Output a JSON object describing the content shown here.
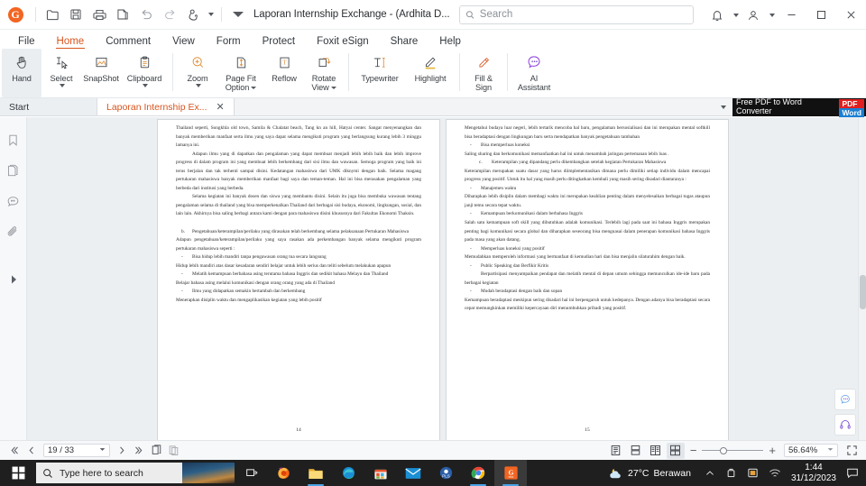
{
  "window": {
    "document_title": "Laporan Internship Exchange - (Ardhita D...",
    "app_logo": "foxit-logo-icon"
  },
  "search": {
    "placeholder": "Search",
    "value": ""
  },
  "titlebar_icons": [
    "open-folder-icon",
    "save-icon",
    "print-icon",
    "copy-icon",
    "undo-icon",
    "redo-icon",
    "touch-mode-icon",
    "chevron-down-icon"
  ],
  "titlebar_right": {
    "notifications": "bell-icon",
    "account": "account-icon",
    "minimize": "minimize-icon",
    "maximize": "maximize-icon",
    "close": "close-icon"
  },
  "menu": {
    "items": [
      {
        "label": "File",
        "active": false
      },
      {
        "label": "Home",
        "active": true
      },
      {
        "label": "Comment",
        "active": false
      },
      {
        "label": "View",
        "active": false
      },
      {
        "label": "Form",
        "active": false
      },
      {
        "label": "Protect",
        "active": false
      },
      {
        "label": "Foxit eSign",
        "active": false
      },
      {
        "label": "Share",
        "active": false
      },
      {
        "label": "Help",
        "active": false
      }
    ]
  },
  "ribbon": {
    "groups": [
      {
        "buttons": [
          {
            "label": "Hand",
            "icon": "hand-icon",
            "caret": false,
            "active": true
          },
          {
            "label": "Select",
            "icon": "select-text-icon",
            "caret": true,
            "active": false
          },
          {
            "label": "SnapShot",
            "icon": "snapshot-icon",
            "caret": false,
            "active": false
          },
          {
            "label": "Clipboard",
            "icon": "clipboard-icon",
            "caret": true,
            "active": false
          }
        ]
      },
      {
        "buttons": [
          {
            "label": "Zoom",
            "icon": "zoom-in-icon",
            "caret": true,
            "active": false
          },
          {
            "label": "Page Fit Option",
            "icon": "page-fit-icon",
            "caret": true,
            "active": false
          },
          {
            "label": "Reflow",
            "icon": "reflow-icon",
            "caret": false,
            "active": false
          },
          {
            "label": "Rotate View",
            "icon": "rotate-view-icon",
            "caret": true,
            "active": false
          }
        ]
      },
      {
        "buttons": [
          {
            "label": "Typewriter",
            "icon": "typewriter-icon",
            "caret": false,
            "active": false
          },
          {
            "label": "Highlight",
            "icon": "highlight-icon",
            "caret": false,
            "active": false
          }
        ]
      },
      {
        "buttons": [
          {
            "label": "Fill & Sign",
            "icon": "fill-sign-icon",
            "caret": false,
            "active": false
          }
        ]
      },
      {
        "buttons": [
          {
            "label": "AI Assistant",
            "icon": "ai-assistant-icon",
            "caret": false,
            "active": false
          }
        ]
      }
    ]
  },
  "tabs": [
    {
      "label": "Start",
      "active": false,
      "closable": false
    },
    {
      "label": "Laporan Internship Ex...",
      "active": true,
      "closable": true
    }
  ],
  "ad": {
    "line1": "Free PDF to Word",
    "line2": "Converter",
    "badge_pdf": "PDF",
    "badge_word": "Word"
  },
  "left_rail": {
    "items": [
      {
        "name": "bookmarks-icon"
      },
      {
        "name": "page-thumbnails-icon"
      },
      {
        "name": "comments-icon"
      },
      {
        "name": "attachments-icon"
      }
    ],
    "expand": "expand-panel-arrow-icon"
  },
  "document": {
    "left_page": {
      "page_number": "14",
      "blocks": [
        {
          "type": "p",
          "text": "Thailand seperti, Songkhla old town, Samila & Chalatat beach, Tang kn an hill, Hatyai center. Sangat menyenangkan dan banyak memberikan manfaat serta ilmu yang saya dapat selama mengikuti program yang berlangsung kurang lebih 3 minggu lamanya ini."
        },
        {
          "type": "p-indent",
          "text": "Adapun ilmu yang di dapatkan dan pengalaman yang dapat membuat menjadi lebih lebih baik dan lebih improve progress di dalam program ini yang membuat lebih berkembang dari sisi ilmu dan wawasan. Semoga program yang baik ini terus berjalan dan tak terhenti sampai disini. Kedatangan mahasiswa dari UMK diknymi dengan baik. Selama magang pertukaran mahasiswa banyak memberikan manfaat bagi saya dan teman-teman. Hal ini bisa merasakan pengalaman yang berbeda dari institusi yang berbeda."
        },
        {
          "type": "p-indent",
          "text": "Selama kegiatan ini banyak dosen dan siswa yang membantu disini. Selain itu juga bisa membuka wawasan tentang pengalaman selama di thailand yang bisa memperkenalkan Thailand dari berbagai sisi budaya, ekonomi, lingkungan, sosial, dan lain lain. Akhirnya bisa saling berbagi antara kami dengan para mahasiswa disini khususnya dari Fakultas Ekonomi Thaksin."
        },
        {
          "type": "li-b",
          "marker": "b.",
          "text": "Pengetahuan/keterampilan/perilaku yang dirasakan telah berkembang selama pelaksanaan Pertukaran Mahasiswa"
        },
        {
          "type": "p",
          "text": "Adapun pengetahuan/keterampilan/perilaku yang saya rasakan ada perkembangan banyak selama mengikuti program pertukaran mahasiswa seperti :"
        },
        {
          "type": "li-dash",
          "marker": "-",
          "text": "Bisa hidup lebih mandiri tanpa pengawasan orang tua secara langsung"
        },
        {
          "type": "p",
          "text": "Hidup lebih mandiri atas dasar kesadaran sendiri belajar untuk lebih serius dan teliti sebelum melakukan apapun"
        },
        {
          "type": "li-dash",
          "marker": "-",
          "text": "Melatih kemampuan berbahasa asing terutama bahasa Inggris dan sedikit bahasa Melayu dan Thailand"
        },
        {
          "type": "p",
          "text": "Belajar bahasa asing melalui komunikasi dengan orang orang yang ada di Thailand"
        },
        {
          "type": "li-dash",
          "marker": "-",
          "text": "Ilmu yang didapatkan semakin bertambah dan berkembang"
        },
        {
          "type": "p",
          "text": "Menerapkan disiplin waktu dan mengaplikasikan kegiatan yang lebih positif"
        }
      ]
    },
    "right_page": {
      "page_number": "15",
      "blocks": [
        {
          "type": "p",
          "text": "Mengetahui budaya luar negeri, lebih tertarik mencoba hal baru, pengalaman bersosialisasi dan ini merupakan mental softkill bisa beradaptasi dengan lingkungan baru serta mendapatkan banyak pengetahuan tambahan"
        },
        {
          "type": "li-dash",
          "marker": "-",
          "text": "Bisa memperluas koneksi"
        },
        {
          "type": "p",
          "text": "Saling sharing dan berkomunikasi memanfaatkan hal ini untuk menambah jaringan pertemanan lebih luas ."
        },
        {
          "type": "li-b",
          "marker": "c.",
          "text": "Keterampilan yang dipandang perlu dikembangkan setelah kegiatan Pertukaran Mahasiswa"
        },
        {
          "type": "p",
          "text": "Keterampilan merupakan suatu dasar yang harus diimplementasikan dimana perlu dimiliki setiap individu dalam mencapai progress yang positif. Untuk itu hal yang masih perlu ditingkatkan kembali yang masih sering disadari diantaranya :"
        },
        {
          "type": "li-dash",
          "marker": "-",
          "text": "Manajemen waktu"
        },
        {
          "type": "p",
          "text": "Diharapkan lebih disiplin dalam membagi waktu ini merupakan keahlian penting dalam menyelesaikan berbagai tugas ataupun janji temu secara tepat waktu."
        },
        {
          "type": "li-dash",
          "marker": "-",
          "text": "Kemampuan berkomunikasi dalam berbahasa Inggris"
        },
        {
          "type": "p",
          "text": "Salah satu kemampuan soft skill yang dibutuhkan adalah komunikasi. Terlebih lagi pada saat ini bahasa Inggris merupakan penting bagi komunikasi secara global dan diharapkan seseorang bisa menguasai dalam penerapan komunikasi bahasa Inggris pada masa yang akan datang."
        },
        {
          "type": "li-dash",
          "marker": "-",
          "text": "Memperluas koneksi yang positif"
        },
        {
          "type": "p",
          "text": "Memudahkan memperoleh informasi yang bermanfaat di kemudian hari dan bisa menjalin silaturahim dengan baik."
        },
        {
          "type": "li-dash",
          "marker": "-",
          "text": "Public Speaking dan Berfikir Kritis"
        },
        {
          "type": "p-indent",
          "text": "Berpartisipasi menyampaikan pendapat dan melatih mental di depan umum sehingga memunculkan ide-ide baru pada berbagai kegiatan"
        },
        {
          "type": "li-dash",
          "marker": "-",
          "text": "Mudah beradaptasi dengan baik dan sopan"
        },
        {
          "type": "p",
          "text": "Kemampuan beradaptasi meskipun sering disadari hal ini berpengaruh untuk kedepanya. Dengan adanya bisa beradaptasi secara cepat memungkinkan memiliki kepercayaan diri menumbuhkan pribadi yang positif."
        }
      ]
    }
  },
  "right_rail": {
    "buttons": [
      {
        "name": "ai-assistant-float-icon"
      },
      {
        "name": "support-headset-icon"
      }
    ]
  },
  "statusbar": {
    "first_page": "first-page-icon",
    "prev_page": "previous-page-icon",
    "page_value": "19 / 33",
    "next_page": "next-page-icon",
    "last_page": "last-page-icon",
    "single_view": "single-page-view-icon",
    "continuous_view": "continuous-view-icon",
    "view_modes": [
      {
        "name": "single-page-layout-icon",
        "selected": false
      },
      {
        "name": "continuous-layout-icon",
        "selected": false
      },
      {
        "name": "facing-layout-icon",
        "selected": false
      },
      {
        "name": "facing-continuous-layout-icon",
        "selected": true
      }
    ],
    "zoom_out": "−",
    "zoom_in": "+",
    "zoom_value": "56.64%",
    "fullscreen": "fullscreen-icon"
  },
  "taskbar": {
    "start": "windows-start-icon",
    "search_placeholder": "Type here to search",
    "task_view": "task-view-icon",
    "apps": [
      {
        "name": "firefox-icon",
        "running": false
      },
      {
        "name": "file-explorer-icon",
        "running": true
      },
      {
        "name": "microsoft-edge-icon",
        "running": false
      },
      {
        "name": "microsoft-store-icon",
        "running": false
      },
      {
        "name": "mail-icon",
        "running": false
      },
      {
        "name": "pls-app-icon",
        "running": false
      },
      {
        "name": "google-chrome-icon",
        "running": true
      },
      {
        "name": "foxit-pdf-reader-icon",
        "running": true
      }
    ],
    "weather": {
      "icon": "partly-cloudy-night-icon",
      "temp": "27°C",
      "condition": "Berawan"
    },
    "tray": [
      "show-hidden-icons-chevron",
      "onedrive-icon",
      "security-icon",
      "network-icon"
    ],
    "clock": {
      "time": "1:44",
      "date": "31/12/2023"
    },
    "action_center": "action-center-icon"
  },
  "colors": {
    "accent": "#d9541e",
    "brand": "#f26522",
    "taskbar_bg": "#1f1f1f",
    "panel_bg": "#f7f8fa"
  }
}
